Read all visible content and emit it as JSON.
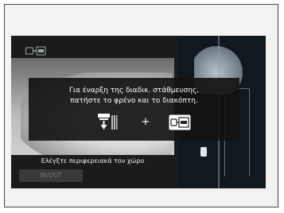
{
  "screen": {
    "instruction": {
      "line1": "Για έναρξη της διαδικ. στάθμευσης,",
      "line2": "πατήστε το φρένο και το διακόπτη."
    },
    "plus": "+",
    "camera_hint": "Ελέγξτε περιφερειακά τον χώρο",
    "inout_label": "IN/OUT"
  },
  "icons": {
    "parking_assist": "parking-assist-icon",
    "brake_pedal": "brake-pedal-icon",
    "parking_switch": "parking-switch-icon"
  },
  "colors": {
    "screen_bg": "#1b1b1b",
    "overlay_bg": "#141414",
    "text": "#ffffff"
  }
}
